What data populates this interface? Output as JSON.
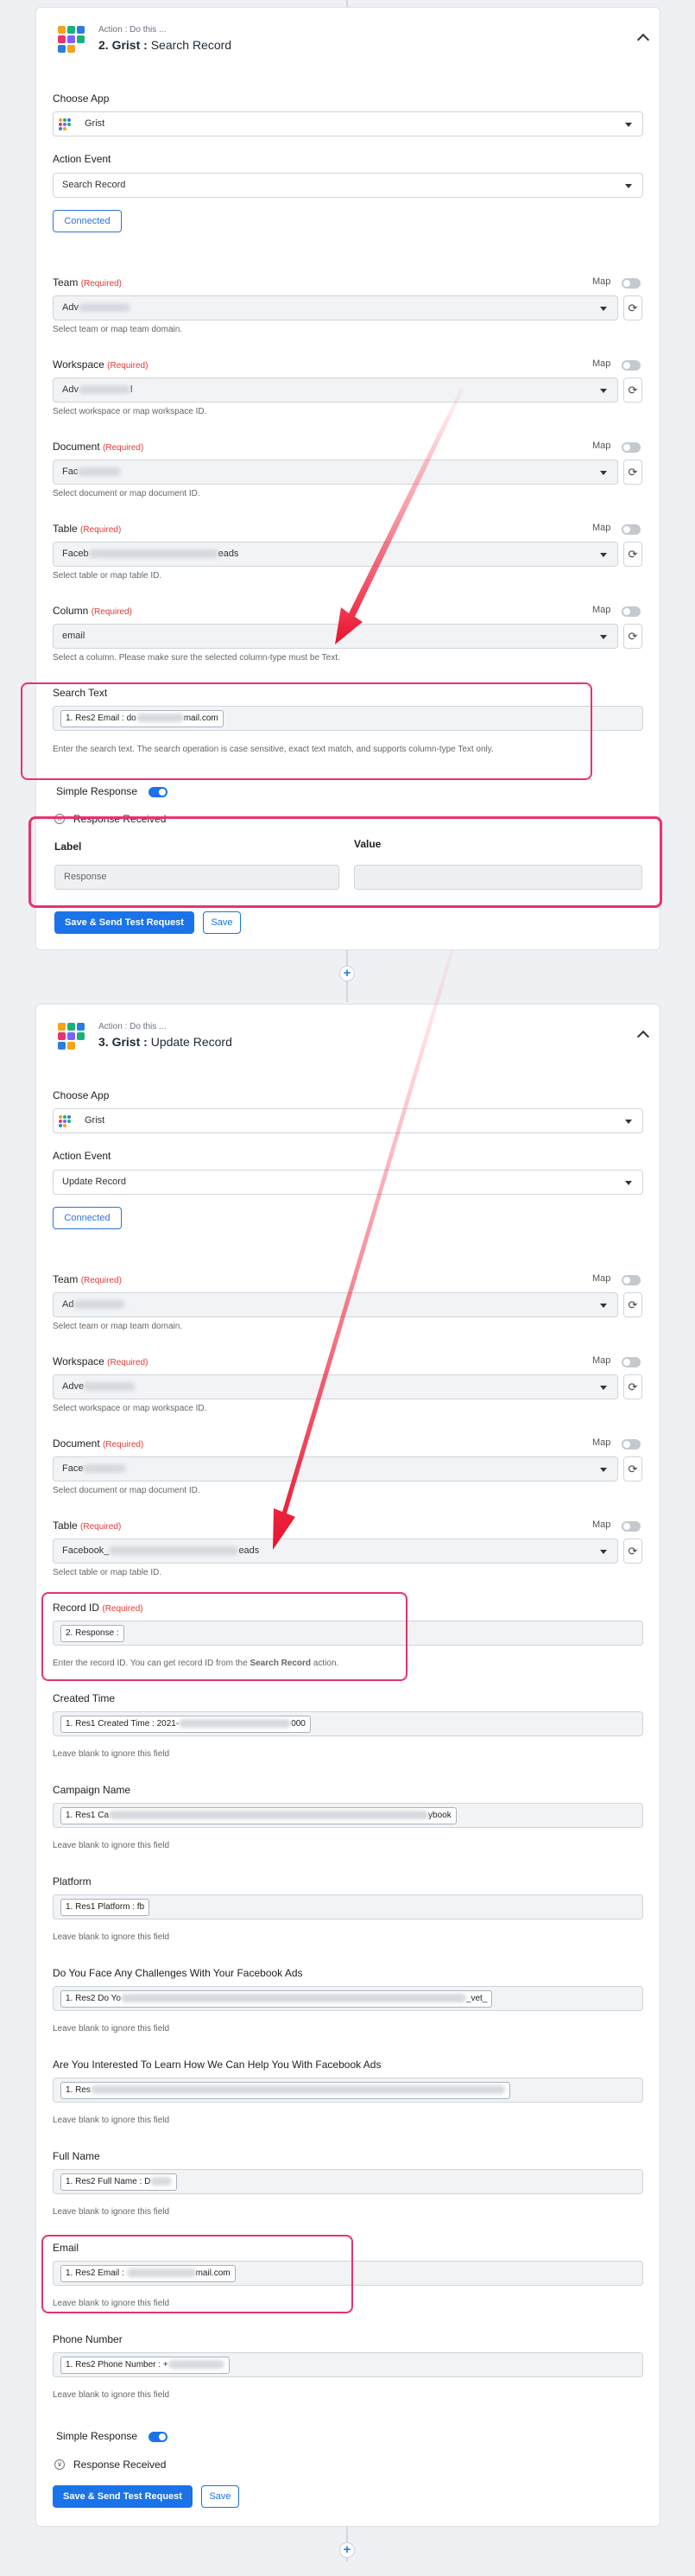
{
  "card1": {
    "pre": "Action : Do this ...",
    "step": "2.",
    "app": "Grist :",
    "action": "Search Record",
    "choose_app_label": "Choose App",
    "app_value": "Grist",
    "action_event_label": "Action Event",
    "action_event_value": "Search Record",
    "connected": "Connected",
    "map": "Map",
    "req": "(Required)",
    "team_label": "Team",
    "team_value": "Adv",
    "team_help": "Select team or map team domain.",
    "workspace_label": "Workspace",
    "workspace_value": "Adv",
    "workspace_tail": "l",
    "workspace_help": "Select workspace or map workspace ID.",
    "document_label": "Document",
    "document_value": "Fac",
    "document_help": "Select document or map document ID.",
    "table_label": "Table",
    "table_value": "Faceb",
    "table_tail": "eads",
    "table_help": "Select table or map table ID.",
    "column_label": "Column",
    "column_value": "email",
    "column_help": "Select a column. Please make sure the selected column-type must be Text.",
    "search_label": "Search Text",
    "search_chip_a": "1. Res2 Email : do",
    "search_chip_b": "mail.com",
    "search_help": "Enter the search text. The search operation is case sensitive, exact text match, and supports column-type Text only.",
    "simple_response": "Simple Response",
    "response_received": "Response Received",
    "label_head": "Label",
    "value_head": "Value",
    "response_label": "Response",
    "send_btn": "Save & Send Test Request",
    "save_btn": "Save"
  },
  "card2": {
    "pre": "Action : Do this ...",
    "step": "3.",
    "app": "Grist :",
    "action": "Update Record",
    "choose_app_label": "Choose App",
    "app_value": "Grist",
    "action_event_label": "Action Event",
    "action_event_value": "Update Record",
    "connected": "Connected",
    "map": "Map",
    "req": "(Required)",
    "team_label": "Team",
    "team_value": "Ad",
    "team_help": "Select team or map team domain.",
    "workspace_label": "Workspace",
    "workspace_value": "Adve",
    "workspace_help": "Select workspace or map workspace ID.",
    "document_label": "Document",
    "document_value": "Face",
    "document_help": "Select document or map document ID.",
    "table_label": "Table",
    "table_value": "Facebook_",
    "table_tail": "eads",
    "table_help": "Select table or map table ID.",
    "record_label": "Record ID",
    "record_chip": "2. Response :",
    "record_help_a": "Enter the record ID. You can get record ID from the ",
    "record_help_b": "Search Record",
    "record_help_c": " action.",
    "blank_help": "Leave blank to ignore this field",
    "created_label": "Created Time",
    "created_chip_a": "1. Res1 Created Time : 2021-",
    "created_chip_b": "000",
    "campaign_label": "Campaign Name",
    "campaign_chip_a": "1. Res1 Ca",
    "campaign_chip_b": "ybook",
    "platform_label": "Platform",
    "platform_chip": "1. Res1 Platform : fb",
    "challenges_label": "Do You Face Any Challenges With Your Facebook Ads",
    "challenges_chip_a": "1. Res2 Do Yo",
    "challenges_chip_b": "_vet_",
    "interested_label": "Are You Interested To Learn How We Can Help You With Facebook Ads",
    "interested_chip_a": "1. Res",
    "fullname_label": "Full Name",
    "fullname_chip_a": "1. Res2 Full Name : D",
    "email_label": "Email",
    "email_chip_a": "1. Res2 Email :",
    "email_chip_b": "mail.com",
    "phone_label": "Phone Number",
    "phone_chip_a": "1. Res2 Phone Number : +",
    "simple_response": "Simple Response",
    "response_received": "Response Received",
    "send_btn": "Save & Send Test Request",
    "save_btn": "Save"
  },
  "icons": {
    "plus": "+",
    "refresh": "⟳",
    "expand": "∨",
    "collapse": "∧"
  },
  "colors": {
    "accent": "#1a73e8",
    "highlight": "#e8336b",
    "required": "#e53935"
  }
}
